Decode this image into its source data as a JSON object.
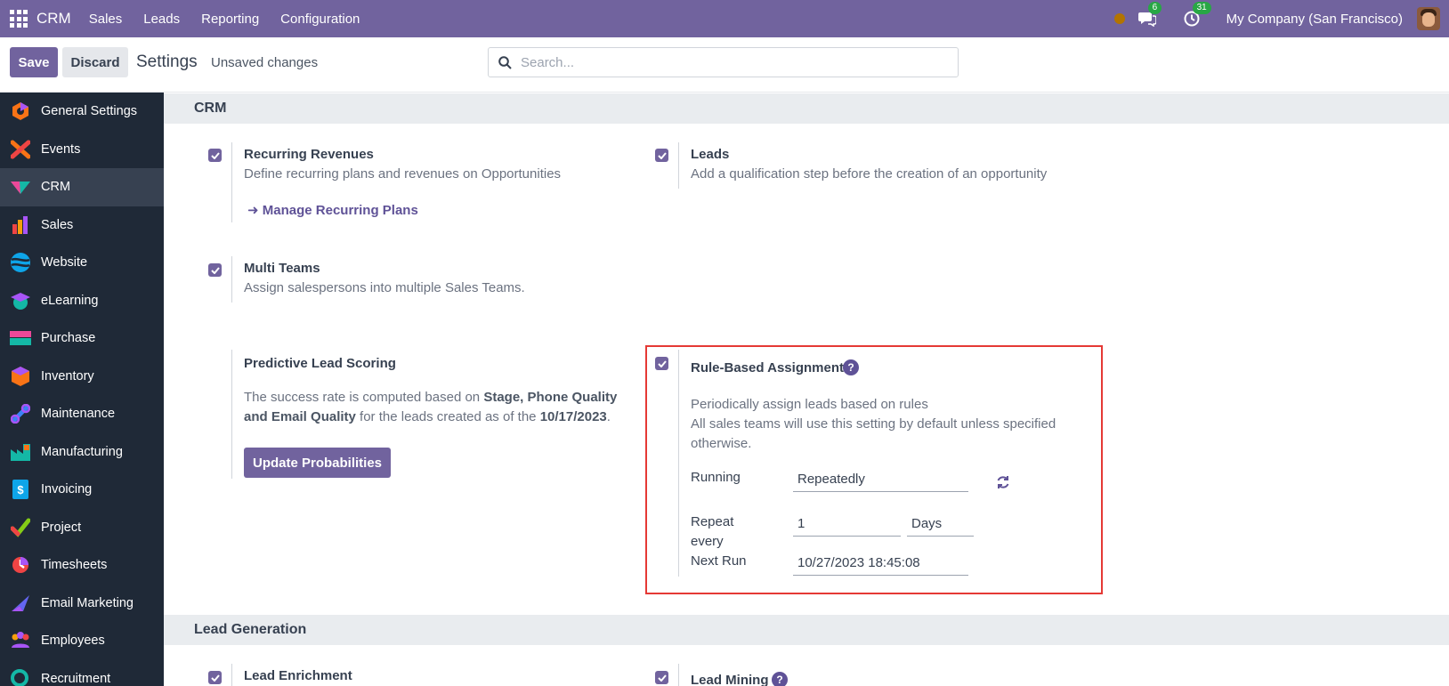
{
  "topbar": {
    "brand": "CRM",
    "menu": [
      "Sales",
      "Leads",
      "Reporting",
      "Configuration"
    ],
    "messages_count": "6",
    "activities_count": "31",
    "company": "My Company (San Francisco)"
  },
  "control": {
    "save_label": "Save",
    "discard_label": "Discard",
    "title": "Settings",
    "unsaved": "Unsaved changes",
    "search_placeholder": "Search..."
  },
  "sidebar": {
    "items": [
      {
        "label": "General Settings",
        "icon": "general-settings-icon",
        "color": "#f97316"
      },
      {
        "label": "Events",
        "icon": "events-icon",
        "color": "#ef4444"
      },
      {
        "label": "CRM",
        "icon": "crm-icon",
        "color": "#14b8a6"
      },
      {
        "label": "Sales",
        "icon": "sales-icon",
        "color": "#f59e0b"
      },
      {
        "label": "Website",
        "icon": "website-icon",
        "color": "#0ea5e9"
      },
      {
        "label": "eLearning",
        "icon": "elearning-icon",
        "color": "#10b981"
      },
      {
        "label": "Purchase",
        "icon": "purchase-icon",
        "color": "#22c55e"
      },
      {
        "label": "Inventory",
        "icon": "inventory-icon",
        "color": "#f97316"
      },
      {
        "label": "Maintenance",
        "icon": "maintenance-icon",
        "color": "#3b82f6"
      },
      {
        "label": "Manufacturing",
        "icon": "manufacturing-icon",
        "color": "#14b8a6"
      },
      {
        "label": "Invoicing",
        "icon": "invoicing-icon",
        "color": "#0ea5e9"
      },
      {
        "label": "Project",
        "icon": "project-icon",
        "color": "#84cc16"
      },
      {
        "label": "Timesheets",
        "icon": "timesheets-icon",
        "color": "#ef4444"
      },
      {
        "label": "Email Marketing",
        "icon": "email-marketing-icon",
        "color": "#6366f1"
      },
      {
        "label": "Employees",
        "icon": "employees-icon",
        "color": "#f59e0b"
      },
      {
        "label": "Recruitment",
        "icon": "recruitment-icon",
        "color": "#14b8a6"
      }
    ]
  },
  "crm_section": {
    "title": "CRM",
    "recurring": {
      "title": "Recurring Revenues",
      "desc": "Define recurring plans and revenues on Opportunities",
      "link": "Manage Recurring Plans"
    },
    "leads": {
      "title": "Leads",
      "desc": "Add a qualification step before the creation of an opportunity"
    },
    "multi_teams": {
      "title": "Multi Teams",
      "desc": "Assign salespersons into multiple Sales Teams."
    },
    "predictive": {
      "title": "Predictive Lead Scoring",
      "desc_1": "The success rate is computed based on",
      "desc_bold": "Stage, Phone Quality",
      "desc_bold_2": "and Email Quality",
      "desc_2": "for the leads created as of the",
      "date": "10/17/2023",
      "button": "Update Probabilities"
    },
    "rule_based": {
      "title": "Rule-Based Assignment",
      "desc_1": "Periodically assign leads based on rules",
      "desc_2": "All sales teams will use this setting by default unless specified",
      "desc_3": "otherwise.",
      "running_label": "Running",
      "running_value": "Repeatedly",
      "repeat_label_1": "Repeat",
      "repeat_label_2": "every",
      "repeat_value": "1",
      "repeat_unit": "Days",
      "next_run_label": "Next Run",
      "next_run_value": "10/27/2023 18:45:08"
    }
  },
  "lead_gen_section": {
    "title": "Lead Generation",
    "enrichment": "Lead Enrichment",
    "mining": "Lead Mining"
  }
}
